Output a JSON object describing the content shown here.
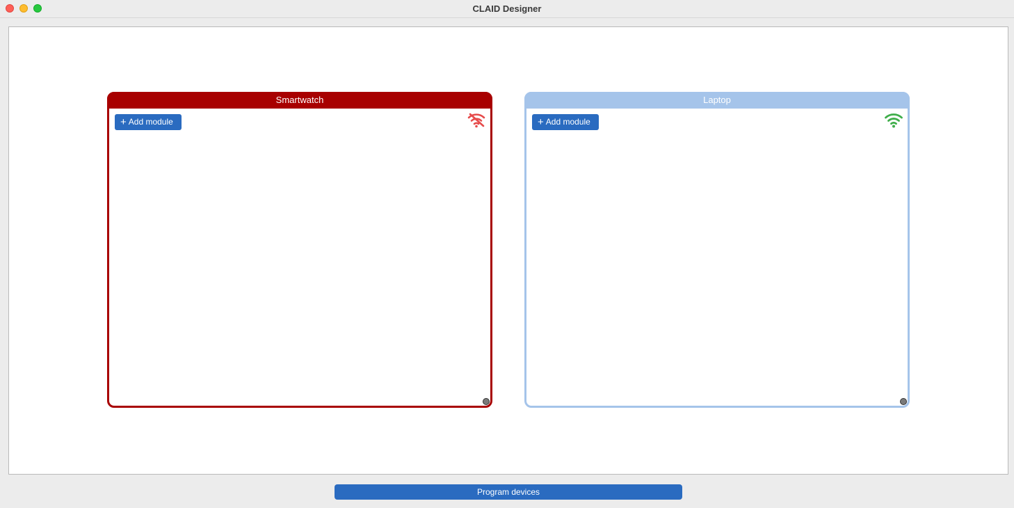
{
  "window": {
    "title": "CLAID Designer"
  },
  "devices": [
    {
      "name": "Smartwatch",
      "add_label": "Add module",
      "connection": "disconnected",
      "connection_icon": "wifi-off-icon",
      "color": "#a80000",
      "icon_color": "#e64b4b"
    },
    {
      "name": "Laptop",
      "add_label": "Add module",
      "connection": "connected",
      "connection_icon": "wifi-icon",
      "color": "#a5c4ea",
      "icon_color": "#3fae4a"
    }
  ],
  "footer": {
    "program_label": "Program devices",
    "accent": "#2a6bc0"
  }
}
